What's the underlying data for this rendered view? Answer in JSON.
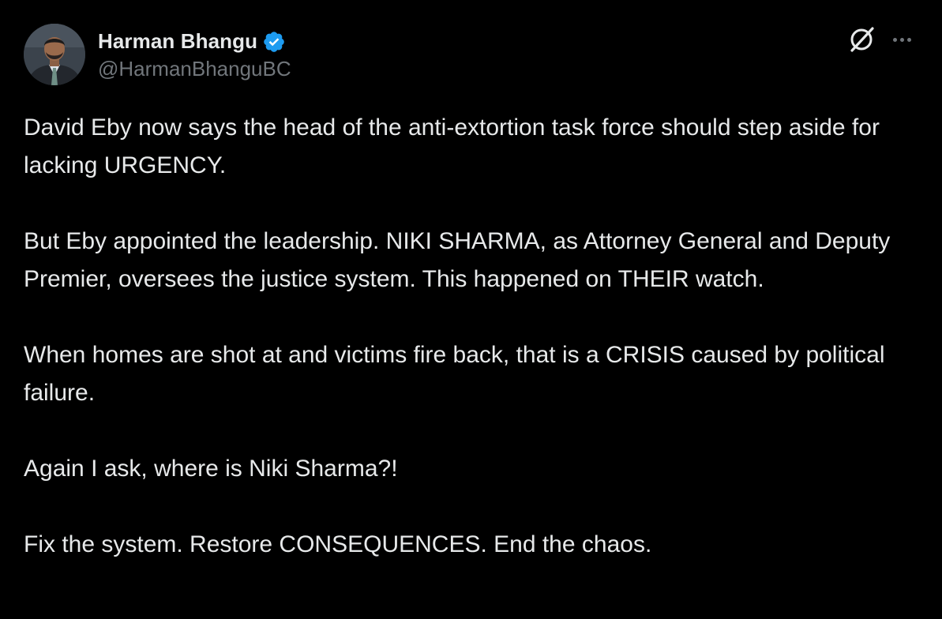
{
  "author": {
    "display_name": "Harman Bhangu",
    "handle": "@HarmanBhanguBC",
    "verified": true,
    "verified_badge_color": "#1d9bf0",
    "avatar_icon": "avatar-photo"
  },
  "actions": {
    "grok_icon": "grok-icon",
    "more_icon": "more-icon"
  },
  "post": {
    "paragraphs": [
      "David Eby now says the head of the anti-extortion task force should step aside for lacking URGENCY.",
      "But Eby appointed the leadership. NIKI SHARMA, as Attorney General and Deputy Premier, oversees the justice system. This happened on THEIR watch.",
      "When homes are shot at and victims fire back, that is a CRISIS caused by political failure.",
      "Again I ask, where is Niki Sharma?!",
      "Fix the system. Restore CONSEQUENCES. End the chaos."
    ]
  },
  "colors": {
    "background": "#000000",
    "primary_text": "#e7e9ea",
    "secondary_text": "#71767b"
  }
}
